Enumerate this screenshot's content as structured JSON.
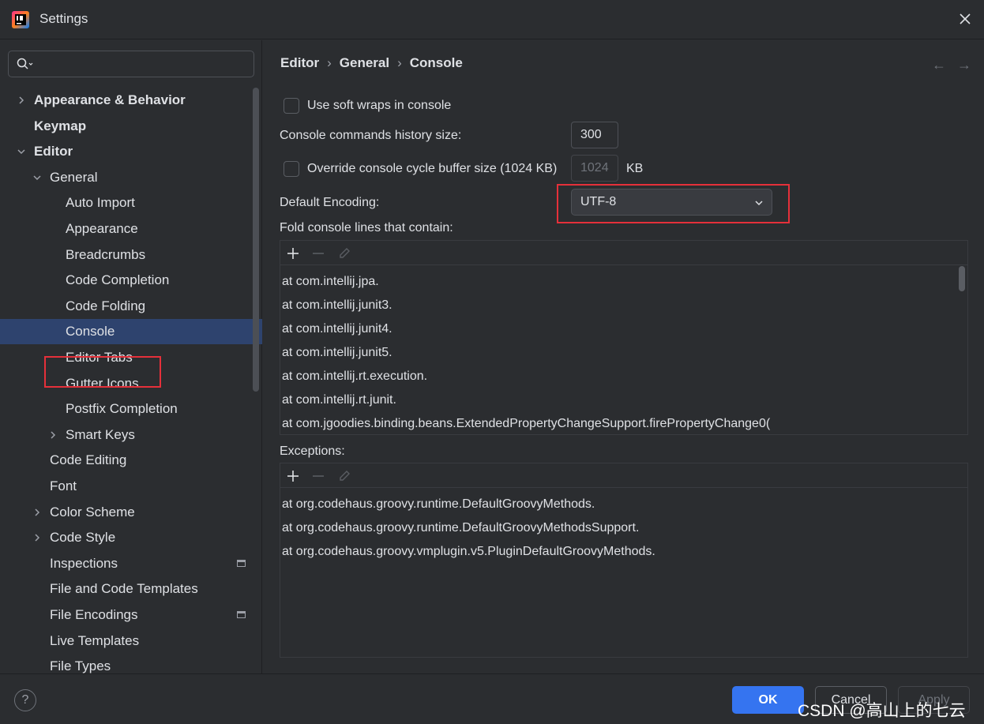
{
  "window": {
    "title": "Settings"
  },
  "search": {
    "value": "",
    "placeholder": ""
  },
  "tree": [
    {
      "label": "Appearance & Behavior",
      "bold": true,
      "chevron": "right"
    },
    {
      "label": "Keymap",
      "bold": true,
      "chevron": ""
    },
    {
      "label": "Editor",
      "bold": true,
      "chevron": "down"
    },
    {
      "label": "General",
      "bold": false,
      "chevron": "down"
    },
    {
      "label": "Auto Import",
      "bold": false,
      "chevron": ""
    },
    {
      "label": "Appearance",
      "bold": false,
      "chevron": ""
    },
    {
      "label": "Breadcrumbs",
      "bold": false,
      "chevron": ""
    },
    {
      "label": "Code Completion",
      "bold": false,
      "chevron": ""
    },
    {
      "label": "Code Folding",
      "bold": false,
      "chevron": ""
    },
    {
      "label": "Console",
      "bold": false,
      "chevron": "",
      "selected": true
    },
    {
      "label": "Editor Tabs",
      "bold": false,
      "chevron": ""
    },
    {
      "label": "Gutter Icons",
      "bold": false,
      "chevron": ""
    },
    {
      "label": "Postfix Completion",
      "bold": false,
      "chevron": ""
    },
    {
      "label": "Smart Keys",
      "bold": false,
      "chevron": "right"
    },
    {
      "label": "Code Editing",
      "bold": false,
      "chevron": ""
    },
    {
      "label": "Font",
      "bold": false,
      "chevron": ""
    },
    {
      "label": "Color Scheme",
      "bold": false,
      "chevron": "right"
    },
    {
      "label": "Code Style",
      "bold": false,
      "chevron": "right"
    },
    {
      "label": "Inspections",
      "bold": false,
      "chevron": "",
      "pin": true
    },
    {
      "label": "File and Code Templates",
      "bold": false,
      "chevron": ""
    },
    {
      "label": "File Encodings",
      "bold": false,
      "chevron": "",
      "pin": true
    },
    {
      "label": "Live Templates",
      "bold": false,
      "chevron": ""
    },
    {
      "label": "File Types",
      "bold": false,
      "chevron": ""
    }
  ],
  "breadcrumb": [
    "Editor",
    "General",
    "Console"
  ],
  "settings": {
    "soft_wraps_label": "Use soft wraps in console",
    "history_label": "Console commands history size:",
    "history_value": "300",
    "override_label": "Override console cycle buffer size (1024 KB)",
    "buffer_value": "1024",
    "buffer_unit": "KB",
    "encoding_label": "Default Encoding:",
    "encoding_value": "UTF-8",
    "fold_label": "Fold console lines that contain:",
    "exceptions_label": "Exceptions:"
  },
  "fold_lines": [
    "at com.intellij.jpa.",
    "at com.intellij.junit3.",
    "at com.intellij.junit4.",
    "at com.intellij.junit5.",
    "at com.intellij.rt.execution.",
    "at com.intellij.rt.junit.",
    "at com.jgoodies.binding.beans.ExtendedPropertyChangeSupport.firePropertyChange0("
  ],
  "exceptions": [
    "at org.codehaus.groovy.runtime.DefaultGroovyMethods.",
    "at org.codehaus.groovy.runtime.DefaultGroovyMethodsSupport.",
    "at org.codehaus.groovy.vmplugin.v5.PluginDefaultGroovyMethods."
  ],
  "footer": {
    "help": "?",
    "ok": "OK",
    "cancel": "Cancel",
    "apply": "Apply",
    "watermark": "CSDN @高山上的七云"
  },
  "colors": {
    "accent": "#3574f0",
    "selection": "#2e436e",
    "highlight": "#e5303a",
    "background": "#2b2d30"
  }
}
